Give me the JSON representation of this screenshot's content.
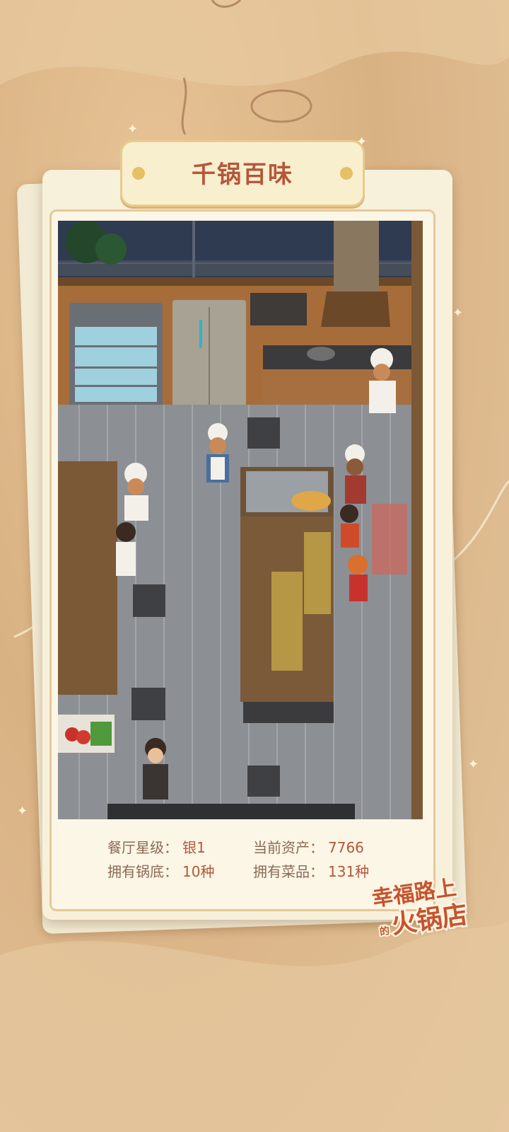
{
  "title": "千锅百味",
  "stats": [
    {
      "label": "餐厅星级：",
      "value": "银1"
    },
    {
      "label": "当前资产：",
      "value": "7766"
    },
    {
      "label": "拥有锅底：",
      "value": "10种"
    },
    {
      "label": "拥有菜品：",
      "value": "131种"
    }
  ],
  "logo": {
    "line1": "幸福路上",
    "small": "的",
    "line2": "火锅店"
  },
  "colors": {
    "accent": "#b5573b",
    "label": "#8b6a55",
    "plate": "#f8efcf",
    "background": "#d9b283"
  }
}
